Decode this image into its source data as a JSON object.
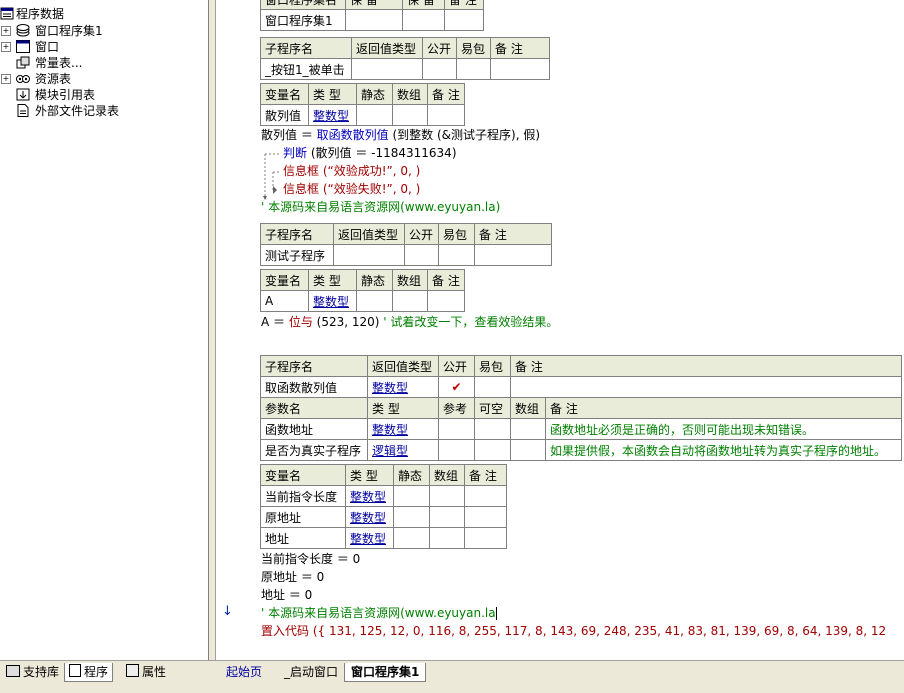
{
  "tree": {
    "root": "程序数据",
    "items": [
      {
        "label": "窗口程序集1",
        "expander": "+",
        "icon": "assembly-icon"
      },
      {
        "label": "窗口",
        "expander": "+",
        "icon": "window-icon"
      },
      {
        "label": "常量表...",
        "expander": "",
        "icon": "constant-icon"
      },
      {
        "label": "资源表",
        "expander": "+",
        "icon": "resource-icon"
      },
      {
        "label": "模块引用表",
        "expander": "",
        "icon": "module-icon"
      },
      {
        "label": "外部文件记录表",
        "expander": "",
        "icon": "file-icon"
      }
    ]
  },
  "left_tabs": [
    "支持库",
    "程序",
    "属性"
  ],
  "code_tabs": [
    "起始页",
    "_启动窗口",
    "窗口程序集1"
  ],
  "code": {
    "asm_table": {
      "header": [
        "窗口程序集名",
        "保 留",
        "保 留",
        "备 注"
      ],
      "row": [
        "窗口程序集1",
        "",
        "",
        ""
      ]
    },
    "sub1": {
      "header": [
        "子程序名",
        "返回值类型",
        "公开",
        "易包",
        "备 注"
      ],
      "row": [
        "_按钮1_被单击",
        "",
        "",
        "",
        ""
      ]
    },
    "var1": {
      "header": [
        "变量名",
        "类 型",
        "静态",
        "数组",
        "备 注"
      ],
      "row": [
        "散列值",
        "整数型",
        "",
        "",
        ""
      ]
    },
    "lines1": {
      "l1a": "散列值 ＝ ",
      "l1b": "取函数散列值",
      "l1c": " (到整数 (&测试子程序), 假)",
      "l2a": "判断",
      "l2b": " (散列值 ＝ -1184311634)",
      "l3a": "信息框",
      "l3b": " (“效验成功!”, 0, )",
      "l4a": "信息框",
      "l4b": " (“效验失败!”, 0, )",
      "l5": "' 本源码来自易语言资源网(www.eyuyan.la)"
    },
    "sub2": {
      "header": [
        "子程序名",
        "返回值类型",
        "公开",
        "易包",
        "备 注"
      ],
      "row": [
        "测试子程序",
        "",
        "",
        "",
        ""
      ]
    },
    "var2": {
      "header": [
        "变量名",
        "类 型",
        "静态",
        "数组",
        "备 注"
      ],
      "row": [
        "A",
        "整数型",
        "",
        "",
        ""
      ]
    },
    "line_a": {
      "a": "A ＝ ",
      "b": "位与",
      "c": " (523, 120)",
      "d": " ' 试着改变一下，查看效验结果。"
    },
    "sub3": {
      "header": [
        "子程序名",
        "返回值类型",
        "公开",
        "易包",
        "备 注"
      ],
      "row": [
        "取函数散列值",
        "整数型",
        "✔",
        "",
        ""
      ],
      "param_header": [
        "参数名",
        "类 型",
        "参考",
        "可空",
        "数组",
        "备 注"
      ],
      "params": [
        [
          "函数地址",
          "整数型",
          "",
          "",
          "",
          "函数地址必须是正确的，否则可能出现未知错误。"
        ],
        [
          "是否为真实子程序",
          "逻辑型",
          "",
          "",
          "",
          "如果提供假，本函数会自动将函数地址转为真实子程序的地址。"
        ]
      ]
    },
    "var3": {
      "header": [
        "变量名",
        "类 型",
        "静态",
        "数组",
        "备 注"
      ],
      "rows": [
        [
          "当前指令长度",
          "整数型",
          "",
          "",
          ""
        ],
        [
          "原地址",
          "整数型",
          "",
          "",
          ""
        ],
        [
          "地址",
          "整数型",
          "",
          "",
          ""
        ]
      ]
    },
    "lines2": {
      "m1": "当前指令长度 ＝ 0",
      "m2": "原地址 ＝ 0",
      "m3": "地址 ＝ 0",
      "m4": "' 本源码来自易语言资源网(www.eyuyan.la",
      "m5a": "置入代码",
      "m5b": " ({ 131, 125, 12, 0, 116, 8, 255, 117, 8, 143, 69, 248, 235, 41, 83, 81, 139, 69, 8, 64, 139, 8, 12"
    }
  }
}
